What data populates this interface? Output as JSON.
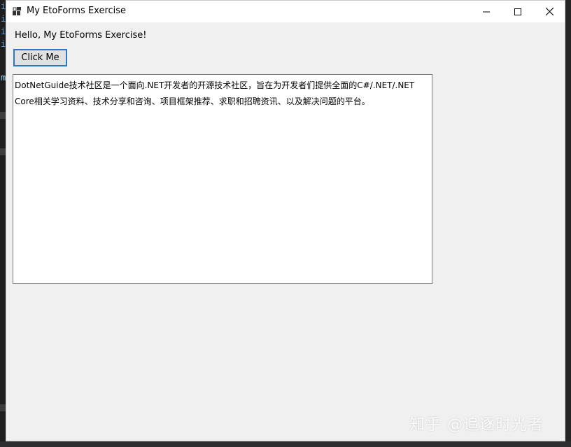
{
  "window": {
    "title": "My EtoForms Exercise",
    "icon": "app-window-icon"
  },
  "controls": {
    "minimize_icon": "minimize-icon",
    "maximize_icon": "maximize-icon",
    "close_icon": "close-icon"
  },
  "content": {
    "hello_label": "Hello, My EtoForms Exercise!",
    "button_label": "Click Me",
    "textarea_value": "DotNetGuide技术社区是一个面向.NET开发者的开源技术社区，旨在为开发者们提供全面的C#/.NET/.NET Core相关学习资料、技术分享和咨询、项目框架推荐、求职和招聘资讯、以及解决问题的平台。"
  },
  "watermark": "知乎 @追逐时光者",
  "colors": {
    "button_border": "#2b78c6",
    "window_bg": "#f0f0f0",
    "ide_bg": "#1e1e1e"
  }
}
